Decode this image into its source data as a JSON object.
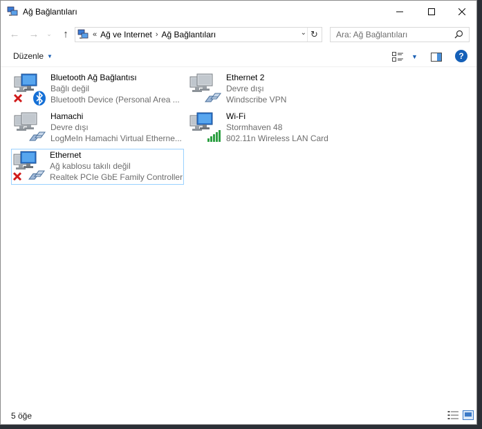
{
  "window": {
    "title": "Ağ Bağlantıları",
    "app_icon": "network-connections-icon"
  },
  "caption_buttons": {
    "minimize": "minimize-icon",
    "maximize": "maximize-icon",
    "close": "close-icon"
  },
  "address": {
    "overflow": "«",
    "crumbs": [
      "Ağ ve Internet",
      "Ağ Bağlantıları"
    ],
    "separator": "›"
  },
  "search": {
    "placeholder": "Ara: Ağ Bağlantıları"
  },
  "toolbar": {
    "organize_label": "Düzenle"
  },
  "connections": [
    {
      "name": "Bluetooth Ağ Bağlantısı",
      "status": "Bağlı değil",
      "device": "Bluetooth Device (Personal Area ...",
      "badge": "bluetooth-icon",
      "error": true
    },
    {
      "name": "Ethernet 2",
      "status": "Devre dışı",
      "device": "Windscribe VPN",
      "badge": "ethernet-cable-icon",
      "error": false
    },
    {
      "name": "Hamachi",
      "status": "Devre dışı",
      "device": "LogMeIn Hamachi Virtual Etherne...",
      "badge": "ethernet-cable-icon",
      "error": false
    },
    {
      "name": "Wi-Fi",
      "status": "Stormhaven 48",
      "device": "802.11n Wireless LAN Card",
      "badge": "wifi-signal-icon",
      "error": false
    },
    {
      "name": "Ethernet",
      "status": "Ağ kablosu takılı değil",
      "device": "Realtek PCIe GbE Family Controller",
      "badge": "ethernet-cable-icon",
      "error": true
    }
  ],
  "status_bar": {
    "item_count": "5 öğe"
  },
  "colors": {
    "accent": "#1560b8",
    "selection_border": "#99d1ff",
    "secondary_text": "#6d6d6d",
    "error_red": "#d01a1a",
    "signal_green": "#2ea043"
  }
}
